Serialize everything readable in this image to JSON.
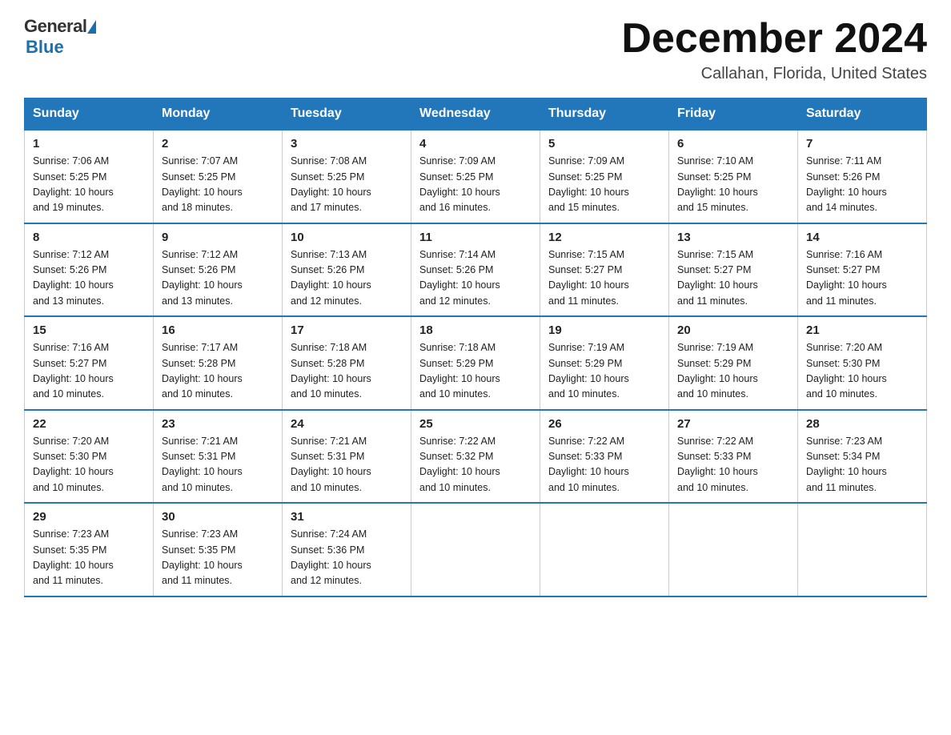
{
  "header": {
    "logo_general": "General",
    "logo_blue": "Blue",
    "title": "December 2024",
    "location": "Callahan, Florida, United States"
  },
  "days_of_week": [
    "Sunday",
    "Monday",
    "Tuesday",
    "Wednesday",
    "Thursday",
    "Friday",
    "Saturday"
  ],
  "weeks": [
    [
      {
        "num": "1",
        "sunrise": "7:06 AM",
        "sunset": "5:25 PM",
        "daylight": "10 hours and 19 minutes."
      },
      {
        "num": "2",
        "sunrise": "7:07 AM",
        "sunset": "5:25 PM",
        "daylight": "10 hours and 18 minutes."
      },
      {
        "num": "3",
        "sunrise": "7:08 AM",
        "sunset": "5:25 PM",
        "daylight": "10 hours and 17 minutes."
      },
      {
        "num": "4",
        "sunrise": "7:09 AM",
        "sunset": "5:25 PM",
        "daylight": "10 hours and 16 minutes."
      },
      {
        "num": "5",
        "sunrise": "7:09 AM",
        "sunset": "5:25 PM",
        "daylight": "10 hours and 15 minutes."
      },
      {
        "num": "6",
        "sunrise": "7:10 AM",
        "sunset": "5:25 PM",
        "daylight": "10 hours and 15 minutes."
      },
      {
        "num": "7",
        "sunrise": "7:11 AM",
        "sunset": "5:26 PM",
        "daylight": "10 hours and 14 minutes."
      }
    ],
    [
      {
        "num": "8",
        "sunrise": "7:12 AM",
        "sunset": "5:26 PM",
        "daylight": "10 hours and 13 minutes."
      },
      {
        "num": "9",
        "sunrise": "7:12 AM",
        "sunset": "5:26 PM",
        "daylight": "10 hours and 13 minutes."
      },
      {
        "num": "10",
        "sunrise": "7:13 AM",
        "sunset": "5:26 PM",
        "daylight": "10 hours and 12 minutes."
      },
      {
        "num": "11",
        "sunrise": "7:14 AM",
        "sunset": "5:26 PM",
        "daylight": "10 hours and 12 minutes."
      },
      {
        "num": "12",
        "sunrise": "7:15 AM",
        "sunset": "5:27 PM",
        "daylight": "10 hours and 11 minutes."
      },
      {
        "num": "13",
        "sunrise": "7:15 AM",
        "sunset": "5:27 PM",
        "daylight": "10 hours and 11 minutes."
      },
      {
        "num": "14",
        "sunrise": "7:16 AM",
        "sunset": "5:27 PM",
        "daylight": "10 hours and 11 minutes."
      }
    ],
    [
      {
        "num": "15",
        "sunrise": "7:16 AM",
        "sunset": "5:27 PM",
        "daylight": "10 hours and 10 minutes."
      },
      {
        "num": "16",
        "sunrise": "7:17 AM",
        "sunset": "5:28 PM",
        "daylight": "10 hours and 10 minutes."
      },
      {
        "num": "17",
        "sunrise": "7:18 AM",
        "sunset": "5:28 PM",
        "daylight": "10 hours and 10 minutes."
      },
      {
        "num": "18",
        "sunrise": "7:18 AM",
        "sunset": "5:29 PM",
        "daylight": "10 hours and 10 minutes."
      },
      {
        "num": "19",
        "sunrise": "7:19 AM",
        "sunset": "5:29 PM",
        "daylight": "10 hours and 10 minutes."
      },
      {
        "num": "20",
        "sunrise": "7:19 AM",
        "sunset": "5:29 PM",
        "daylight": "10 hours and 10 minutes."
      },
      {
        "num": "21",
        "sunrise": "7:20 AM",
        "sunset": "5:30 PM",
        "daylight": "10 hours and 10 minutes."
      }
    ],
    [
      {
        "num": "22",
        "sunrise": "7:20 AM",
        "sunset": "5:30 PM",
        "daylight": "10 hours and 10 minutes."
      },
      {
        "num": "23",
        "sunrise": "7:21 AM",
        "sunset": "5:31 PM",
        "daylight": "10 hours and 10 minutes."
      },
      {
        "num": "24",
        "sunrise": "7:21 AM",
        "sunset": "5:31 PM",
        "daylight": "10 hours and 10 minutes."
      },
      {
        "num": "25",
        "sunrise": "7:22 AM",
        "sunset": "5:32 PM",
        "daylight": "10 hours and 10 minutes."
      },
      {
        "num": "26",
        "sunrise": "7:22 AM",
        "sunset": "5:33 PM",
        "daylight": "10 hours and 10 minutes."
      },
      {
        "num": "27",
        "sunrise": "7:22 AM",
        "sunset": "5:33 PM",
        "daylight": "10 hours and 10 minutes."
      },
      {
        "num": "28",
        "sunrise": "7:23 AM",
        "sunset": "5:34 PM",
        "daylight": "10 hours and 11 minutes."
      }
    ],
    [
      {
        "num": "29",
        "sunrise": "7:23 AM",
        "sunset": "5:35 PM",
        "daylight": "10 hours and 11 minutes."
      },
      {
        "num": "30",
        "sunrise": "7:23 AM",
        "sunset": "5:35 PM",
        "daylight": "10 hours and 11 minutes."
      },
      {
        "num": "31",
        "sunrise": "7:24 AM",
        "sunset": "5:36 PM",
        "daylight": "10 hours and 12 minutes."
      },
      null,
      null,
      null,
      null
    ]
  ],
  "labels": {
    "sunrise_prefix": "Sunrise: ",
    "sunset_prefix": "Sunset: ",
    "daylight_prefix": "Daylight: "
  }
}
